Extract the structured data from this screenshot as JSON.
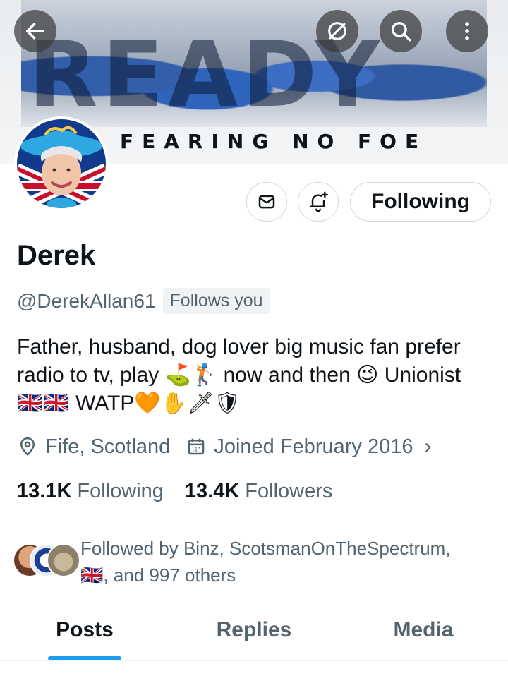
{
  "banner": {
    "word": "READY",
    "tagline": "FEARING NO FOE"
  },
  "topbar": {
    "back_icon": "arrow-left-icon",
    "grok_icon": "slashed-circle-icon",
    "search_icon": "search-icon",
    "more_icon": "more-vertical-icon"
  },
  "actions": {
    "message_icon": "mail-icon",
    "notify_icon": "bell-plus-icon",
    "following_label": "Following"
  },
  "profile": {
    "name": "Derek",
    "handle": "@DerekAllan61",
    "follows_you": "Follows you",
    "bio_line1": "Father, husband, dog lover big music fan prefer",
    "bio_line2_a": "radio to tv, play",
    "bio_line2_emoji": "⛳🏌",
    "bio_line2_b": "now and then",
    "bio_line2_wink": "😉",
    "bio_line2_c": "Unionist",
    "bio_line3_flags": "🇬🇧🇬🇧",
    "bio_line3_text": "WATP",
    "bio_line3_emoji": "🧡✋🗡🛡",
    "location": "Fife, Scotland",
    "joined": "Joined February 2016"
  },
  "stats": {
    "following_count": "13.1K",
    "following_label": "Following",
    "followers_count": "13.4K",
    "followers_label": "Followers"
  },
  "followed_by": {
    "line1": "Followed by Binz, ScotsmanOnTheSpectrum,",
    "line2_flag": "🇬🇧",
    "line2_text": ", and 997 others"
  },
  "tabs": [
    {
      "label": "Posts",
      "active": true
    },
    {
      "label": "Replies",
      "active": false
    },
    {
      "label": "Media",
      "active": false
    }
  ],
  "colors": {
    "accent": "#1d9bf0",
    "text": "#0f1419",
    "secondary": "#536471"
  }
}
